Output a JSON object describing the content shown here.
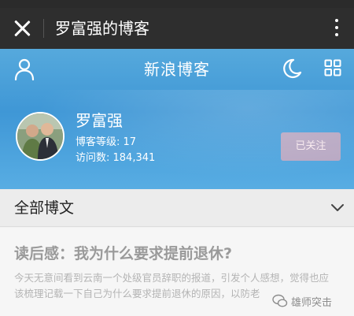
{
  "titlebar": {
    "title": "罗富强的博客",
    "close_icon": "close-icon",
    "more_icon": "more-vertical-icon"
  },
  "header": {
    "brand": "新浪博客",
    "user_icon": "user-icon",
    "night_icon": "moon-icon",
    "menu_icon": "grid-icon"
  },
  "profile": {
    "name": "罗富强",
    "level": "博客等级: 17",
    "visits": "访问数: 184,341",
    "follow_label": "已关注"
  },
  "section": {
    "title": "全部博文"
  },
  "article": {
    "title": "读后感：我为什么要求提前退休?",
    "excerpt": "今天无意间看到云南一个处级官员辞职的报道，引发个人感想，觉得也应该梳理记载一下自己为什么要求提前退休的原因，以防老"
  },
  "watermark": {
    "text": "雄师突击"
  },
  "colors": {
    "titlebar": "#2e2e2e",
    "hero": "#4a9fdc",
    "follow_button": "#dcaab9"
  }
}
